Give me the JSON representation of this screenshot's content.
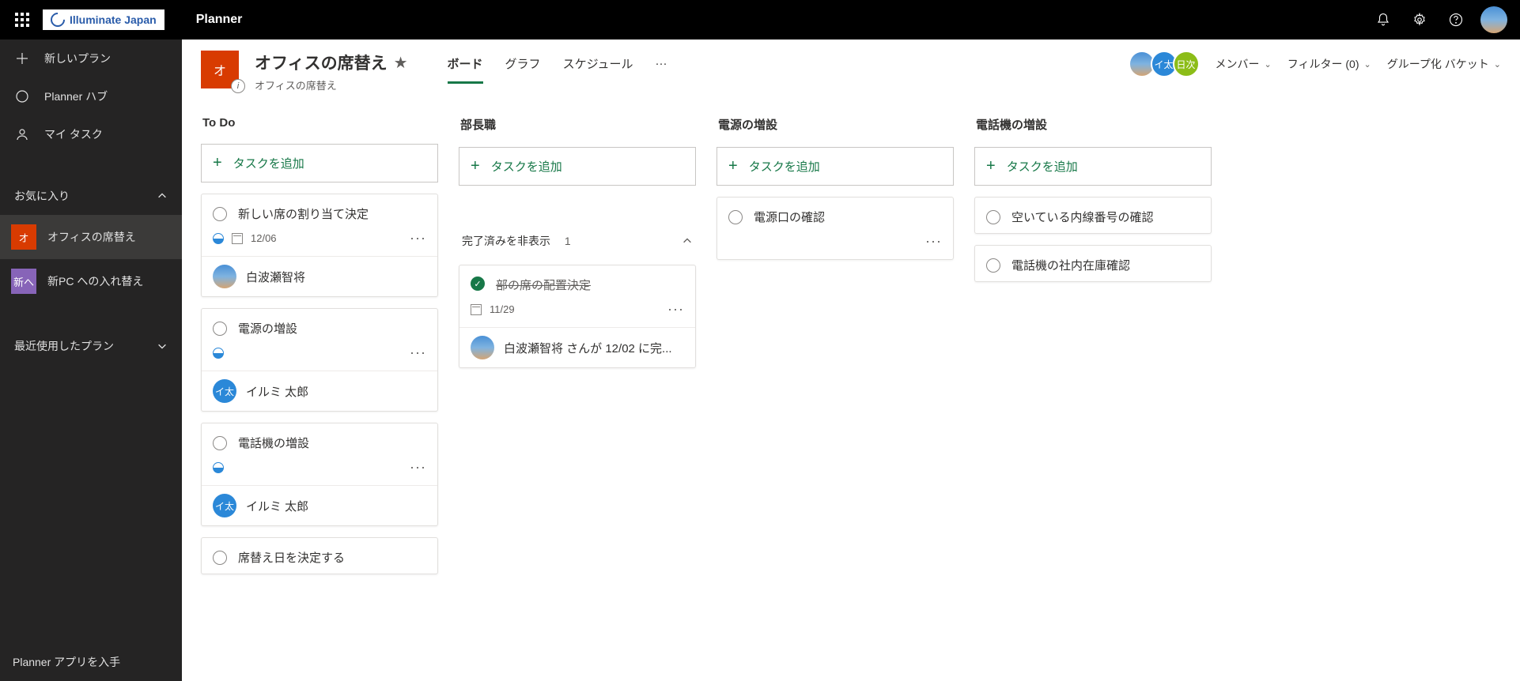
{
  "topbar": {
    "org": "Illuminate Japan",
    "app": "Planner"
  },
  "leftnav": {
    "new_plan": "新しいプラン",
    "hub": "Planner ハブ",
    "my_tasks": "マイ タスク",
    "favorites_header": "お気に入り",
    "recent_header": "最近使用したプラン",
    "get_app": "Planner アプリを入手",
    "plans": [
      {
        "tile": "オ",
        "label": "オフィスの席替え"
      },
      {
        "tile": "新へ",
        "label": "新PC への入れ替え"
      }
    ]
  },
  "header": {
    "tile": "オ",
    "title": "オフィスの席替え",
    "subtitle": "オフィスの席替え",
    "avatars": [
      {
        "type": "photo"
      },
      {
        "type": "blue",
        "text": "イ太"
      },
      {
        "type": "green",
        "text": "日次"
      }
    ],
    "tabs": {
      "board": "ボード",
      "chart": "グラフ",
      "schedule": "スケジュール"
    },
    "members": "メンバー",
    "filter": "フィルター (0)",
    "groupby": "グループ化 バケット"
  },
  "board": {
    "add_task": "タスクを追加",
    "completed_toggle": "完了済みを非表示",
    "completed_count": "1",
    "buckets": [
      {
        "name": "To Do",
        "tasks": [
          {
            "title": "新しい席の割り当て決定",
            "due": "12/06",
            "progress": true,
            "assignee": {
              "name": "白波瀬智将",
              "av": "photo"
            }
          },
          {
            "title": "電源の増設",
            "progress": true,
            "assignee": {
              "name": "イルミ 太郎",
              "av": "blue",
              "avtext": "イ太"
            }
          },
          {
            "title": "電話機の増設",
            "progress": true,
            "assignee": {
              "name": "イルミ 太郎",
              "av": "blue",
              "avtext": "イ太"
            }
          },
          {
            "title": "席替え日を決定する"
          }
        ]
      },
      {
        "name": "部長職",
        "completed_tasks": [
          {
            "title": "部の席の配置決定",
            "due": "11/29",
            "completed_by": "白波瀬智将 さんが 12/02 に完...",
            "av": "photo"
          }
        ]
      },
      {
        "name": "電源の増設",
        "tasks": [
          {
            "title": "電源口の確認"
          }
        ]
      },
      {
        "name": "電話機の増設",
        "tasks": [
          {
            "title": "空いている内線番号の確認"
          },
          {
            "title": "電話機の社内在庫確認"
          }
        ]
      }
    ]
  }
}
